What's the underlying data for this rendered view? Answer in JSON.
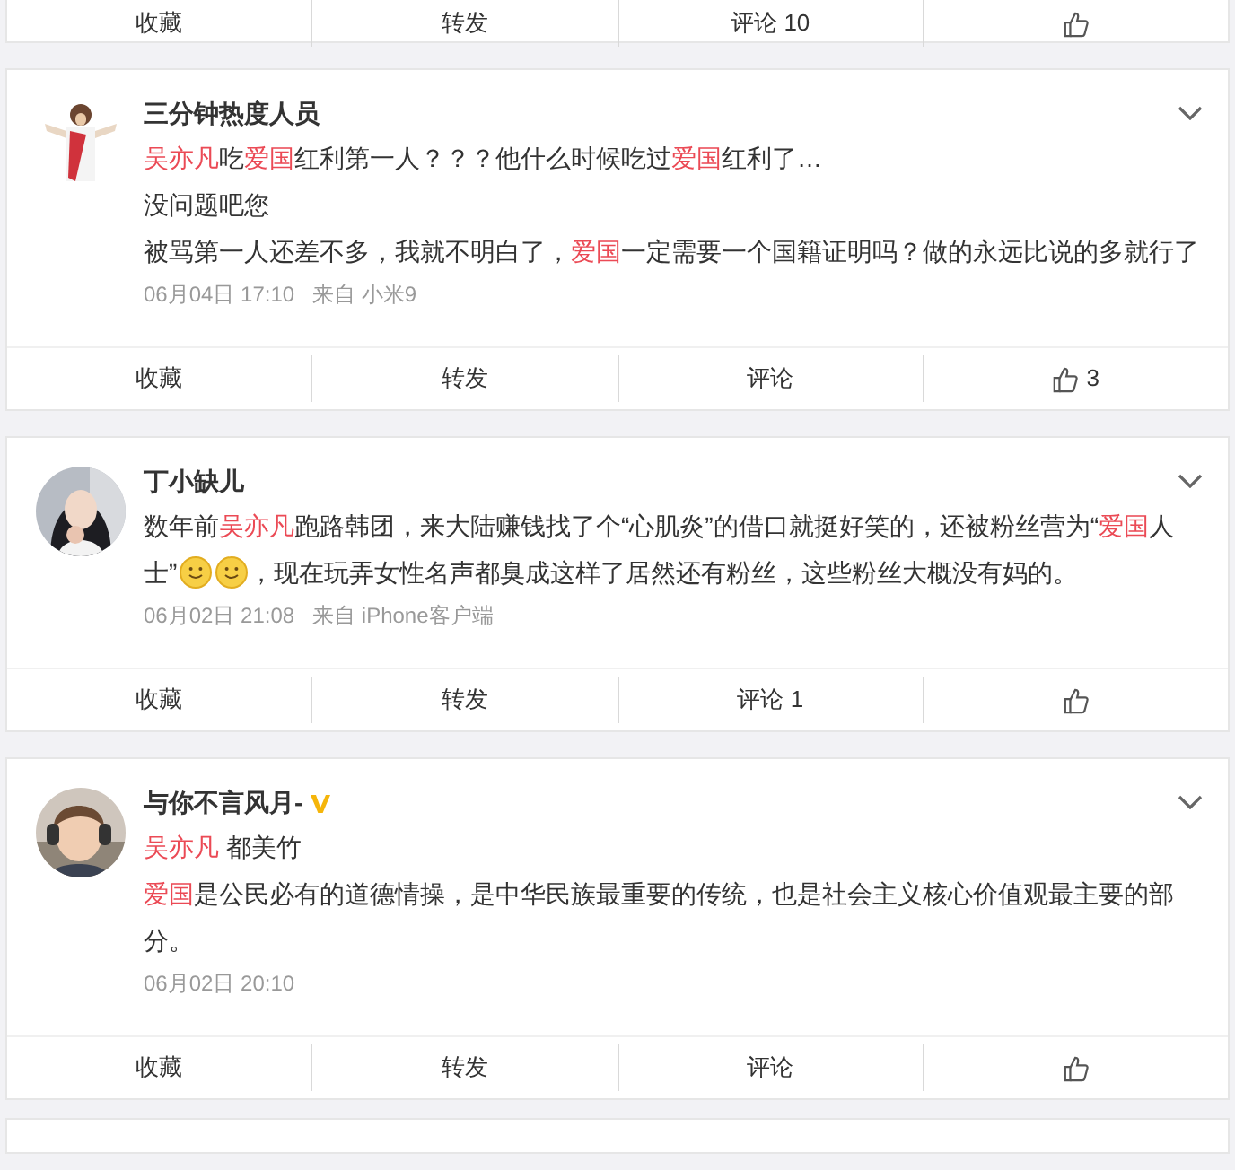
{
  "top_actions": [
    {
      "label": "收藏",
      "kind": "text"
    },
    {
      "label": "转发",
      "kind": "text"
    },
    {
      "label": "评论 10",
      "kind": "text"
    },
    {
      "kind": "like"
    }
  ],
  "comments": [
    {
      "user": "三分钟热度人员",
      "verified": false,
      "paragraphs": [
        [
          {
            "text": "吴亦凡",
            "highlight": true
          },
          {
            "text": "吃",
            "highlight": false
          },
          {
            "text": "爱国",
            "highlight": true
          },
          {
            "text": "红利第一人？？？他什么时候吃过",
            "highlight": false
          },
          {
            "text": "爱国",
            "highlight": true
          },
          {
            "text": "红利了…",
            "highlight": false
          }
        ],
        [
          {
            "text": "没问题吧您",
            "highlight": false
          }
        ],
        [
          {
            "text": "被骂第一人还差不多，我就不明白了，",
            "highlight": false
          },
          {
            "text": "爱国",
            "highlight": true
          },
          {
            "text": "一定需要一个国籍证明吗？做的永远比说的多就行了",
            "highlight": false
          }
        ]
      ],
      "time": "06月04日 17:10",
      "source": "来自 小米9",
      "actions": [
        {
          "label": "收藏",
          "kind": "text"
        },
        {
          "label": "转发",
          "kind": "text"
        },
        {
          "label": "评论",
          "kind": "text"
        },
        {
          "label": "3",
          "kind": "like"
        }
      ]
    },
    {
      "user": "丁小缺儿",
      "verified": false,
      "paragraphs": [
        [
          {
            "text": "数年前",
            "highlight": false
          },
          {
            "text": "吴亦凡",
            "highlight": true
          },
          {
            "text": "跑路韩团，来大陆赚钱找了个“心肌炎”的借口就挺好笑的，还被粉丝营为“",
            "highlight": false
          },
          {
            "text": "爱国",
            "highlight": true
          },
          {
            "text": "人士”",
            "highlight": false
          },
          {
            "kind": "emoji"
          },
          {
            "kind": "emoji"
          },
          {
            "text": "，现在玩弄女性名声都臭成这样了居然还有粉丝，这些粉丝大概没有妈的。",
            "highlight": false
          }
        ]
      ],
      "time": "06月02日 21:08",
      "source": "来自 iPhone客户端",
      "actions": [
        {
          "label": "收藏",
          "kind": "text"
        },
        {
          "label": "转发",
          "kind": "text"
        },
        {
          "label": "评论 1",
          "kind": "text"
        },
        {
          "kind": "like"
        }
      ]
    },
    {
      "user": "与你不言风月-",
      "verified": true,
      "paragraphs": [
        [
          {
            "text": "吴亦凡",
            "highlight": true
          },
          {
            "text": " 都美竹",
            "highlight": false
          }
        ],
        [
          {
            "text": "爱国",
            "highlight": true
          },
          {
            "text": "是公民必有的道德情操，是中华民族最重要的传统，也是社会主义核心价值观最主要的部分。",
            "highlight": false
          }
        ]
      ],
      "time": "06月02日 20:10",
      "actions": [
        {
          "label": "收藏",
          "kind": "text"
        },
        {
          "label": "转发",
          "kind": "text"
        },
        {
          "label": "评论",
          "kind": "text"
        },
        {
          "kind": "like"
        }
      ]
    }
  ]
}
